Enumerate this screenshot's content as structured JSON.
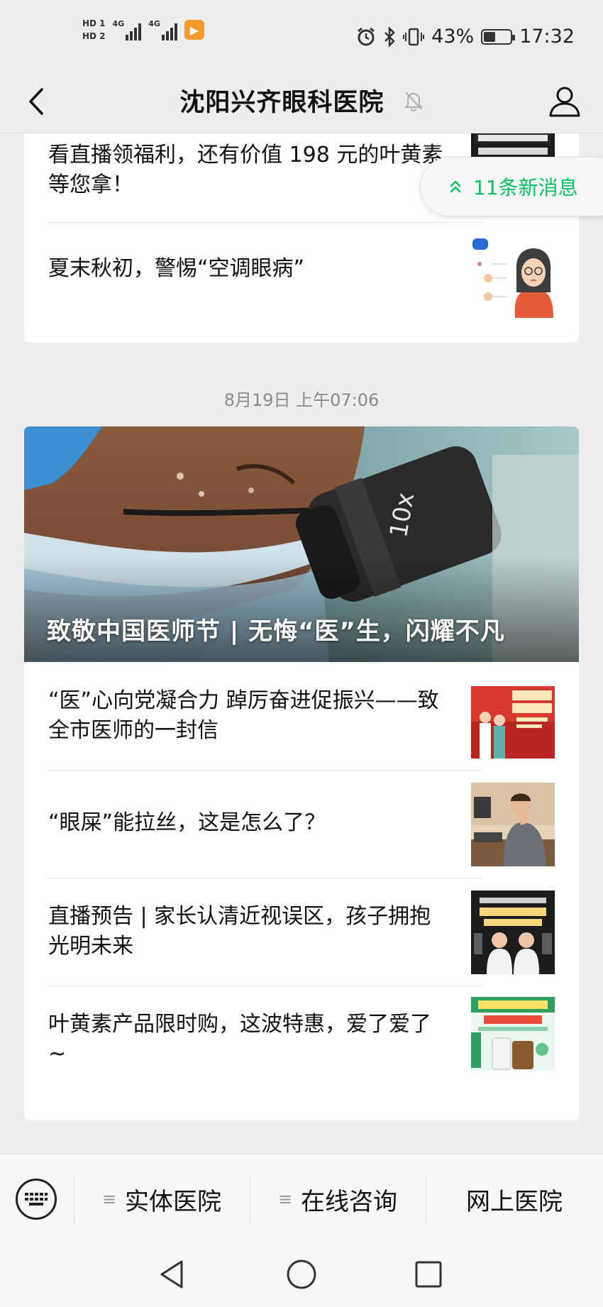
{
  "status_bar": {
    "hd1": "HD 1",
    "hd2": "HD 2",
    "net1": "4G",
    "net2": "4G",
    "battery_pct": "43%",
    "battery_level": 0.43,
    "time": "17:32"
  },
  "nav": {
    "title": "沈阳兴齐眼科医院"
  },
  "new_messages": {
    "label": "11条新消息",
    "color": "#07c160"
  },
  "top_card": {
    "items": [
      {
        "title": "看直播领福利，还有价值 198 元的叶黄素等您拿！"
      },
      {
        "title": "夏末秋初，警惕“空调眼病”"
      }
    ]
  },
  "date_stamp": "8月19日 上午07:06",
  "main_card": {
    "hero_title": "致敬中国医师节 | 无悔“医”生，闪耀不凡",
    "items": [
      {
        "title": "“医”心向党凝合力  踔厉奋进促振兴——致全市医师的一封信"
      },
      {
        "title": "“眼屎”能拉丝，这是怎么了？"
      },
      {
        "title": "直播预告 | 家长认清近视误区，孩子拥抱光明未来"
      },
      {
        "title": "叶黄素产品限时购，这波特惠，爱了爱了~"
      }
    ]
  },
  "bottom_menu": {
    "items": [
      {
        "label": "实体医院"
      },
      {
        "label": "在线咨询"
      },
      {
        "label": "网上医院"
      }
    ]
  }
}
